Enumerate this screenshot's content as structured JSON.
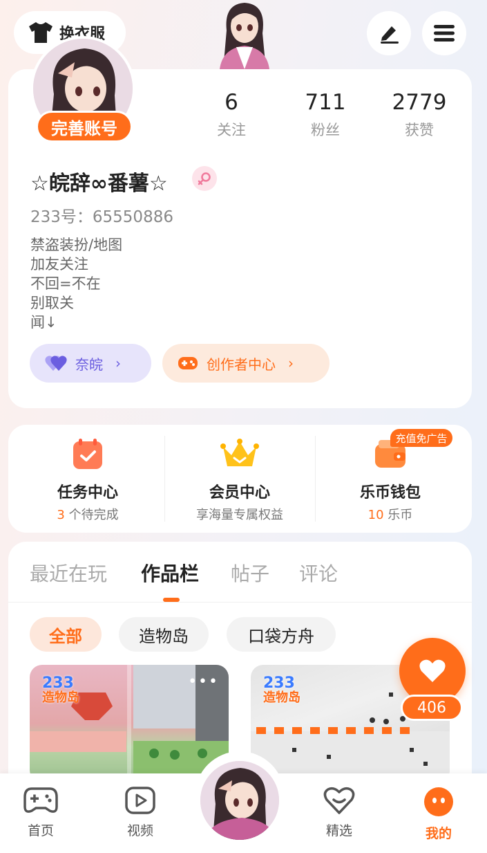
{
  "top": {
    "dress_label": "换衣服",
    "edit_icon": "pen-icon",
    "menu_icon": "menu-icon"
  },
  "profile": {
    "complete_label": "完善账号",
    "stats": [
      {
        "num": "6",
        "label": "关注"
      },
      {
        "num": "711",
        "label": "粉丝"
      },
      {
        "num": "2779",
        "label": "获赞"
      }
    ],
    "nickname": "☆皖辞∞番薯☆",
    "uid": "233号：65550886",
    "bio": [
      "禁盗装扮/地图",
      "加友关注",
      "不回=不在",
      "别取关",
      "闻↓"
    ],
    "pill_partner": "奈皖",
    "pill_creator": "创作者中心"
  },
  "services": {
    "ad_badge": "充值免广告",
    "items": [
      {
        "title": "任务中心",
        "sub_hl": "3",
        "sub": " 个待完成"
      },
      {
        "title": "会员中心",
        "sub_hl": "",
        "sub": "享海量专属权益"
      },
      {
        "title": "乐币钱包",
        "sub_hl": "10",
        "sub": " 乐币"
      }
    ]
  },
  "works": {
    "tabs": [
      "最近在玩",
      "作品栏",
      "帖子",
      "评论"
    ],
    "active_tab": 1,
    "chips": [
      "全部",
      "造物岛",
      "口袋方舟"
    ],
    "thumb_logo": [
      "233",
      "造物岛"
    ],
    "like_count": "406"
  },
  "nav": {
    "items": [
      "首页",
      "视频",
      "精选",
      "我的"
    ]
  },
  "colors": {
    "accent": "#ff6d1a",
    "purple": "#6b5ee0"
  }
}
